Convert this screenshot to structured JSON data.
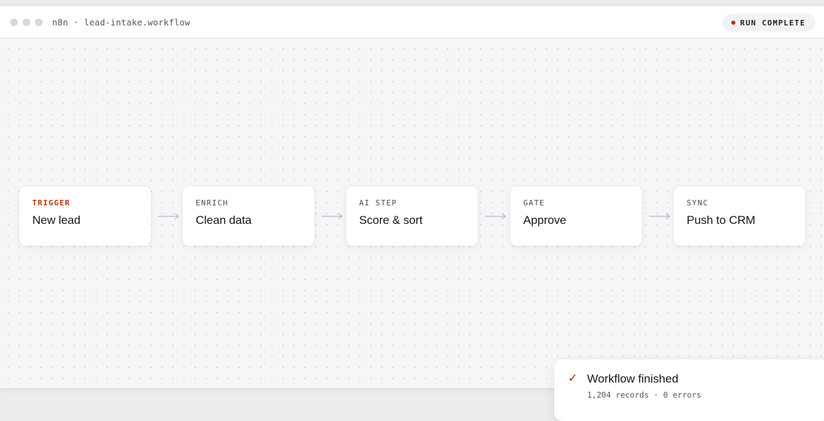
{
  "window": {
    "title": "n8n · lead-intake.workflow",
    "status": "RUN COMPLETE",
    "status_color": "#b3300f"
  },
  "nodes": [
    {
      "tag": "TRIGGER",
      "title": "New lead"
    },
    {
      "tag": "ENRICH",
      "title": "Clean data"
    },
    {
      "tag": "AI STEP",
      "title": "Score & sort"
    },
    {
      "tag": "GATE",
      "title": "Approve"
    },
    {
      "tag": "SYNC",
      "title": "Push to CRM"
    }
  ],
  "toast": {
    "icon": "check-icon",
    "title": "Workflow finished",
    "subtitle": "1,204 records · 0 errors"
  },
  "colors": {
    "accent": "#b33a0c",
    "canvas": "#f6f6f8",
    "card": "#ffffff"
  }
}
